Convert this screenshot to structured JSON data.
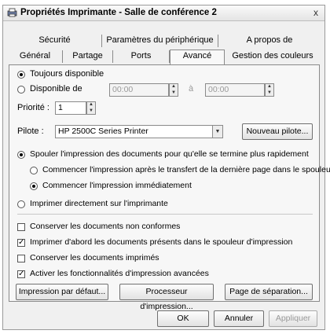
{
  "window": {
    "title": "Propriétés Imprimante - Salle de conférence 2",
    "close": "x"
  },
  "tabs": {
    "row1": [
      "Sécurité",
      "Paramètres du périphérique",
      "A propos de"
    ],
    "row2": [
      "Général",
      "Partage",
      "Ports",
      "Avancé",
      "Gestion des couleurs"
    ]
  },
  "availability": {
    "always": "Toujours disponible",
    "from": "Disponible de",
    "from_value": "00:00",
    "to_word": "à",
    "to_value": "00:00"
  },
  "priority": {
    "label": "Priorité :",
    "value": "1"
  },
  "driver": {
    "label": "Pilote :",
    "value": "HP 2500C Series Printer",
    "new_button": "Nouveau pilote..."
  },
  "spool": {
    "spool_option": "Spouler l'impression des documents pour qu'elle se termine plus rapidement",
    "after_last_page": "Commencer l'impression après le transfert de la dernière page dans le spouleur",
    "immediately": "Commencer l'impression immédiatement",
    "direct": "Imprimer directement sur l'imprimante"
  },
  "options": {
    "keep_nonconforming": "Conserver les documents non conformes",
    "print_spooled_first": "Imprimer d'abord les documents présents dans le spouleur d'impression",
    "keep_printed": "Conserver les documents imprimés",
    "advanced_features": "Activer les fonctionnalités d'impression avancées"
  },
  "panel_buttons": {
    "defaults": "Impression par défaut...",
    "processor": "Processeur d'impression...",
    "separator": "Page de séparation..."
  },
  "footer": {
    "ok": "OK",
    "cancel": "Annuler",
    "apply": "Appliquer"
  }
}
